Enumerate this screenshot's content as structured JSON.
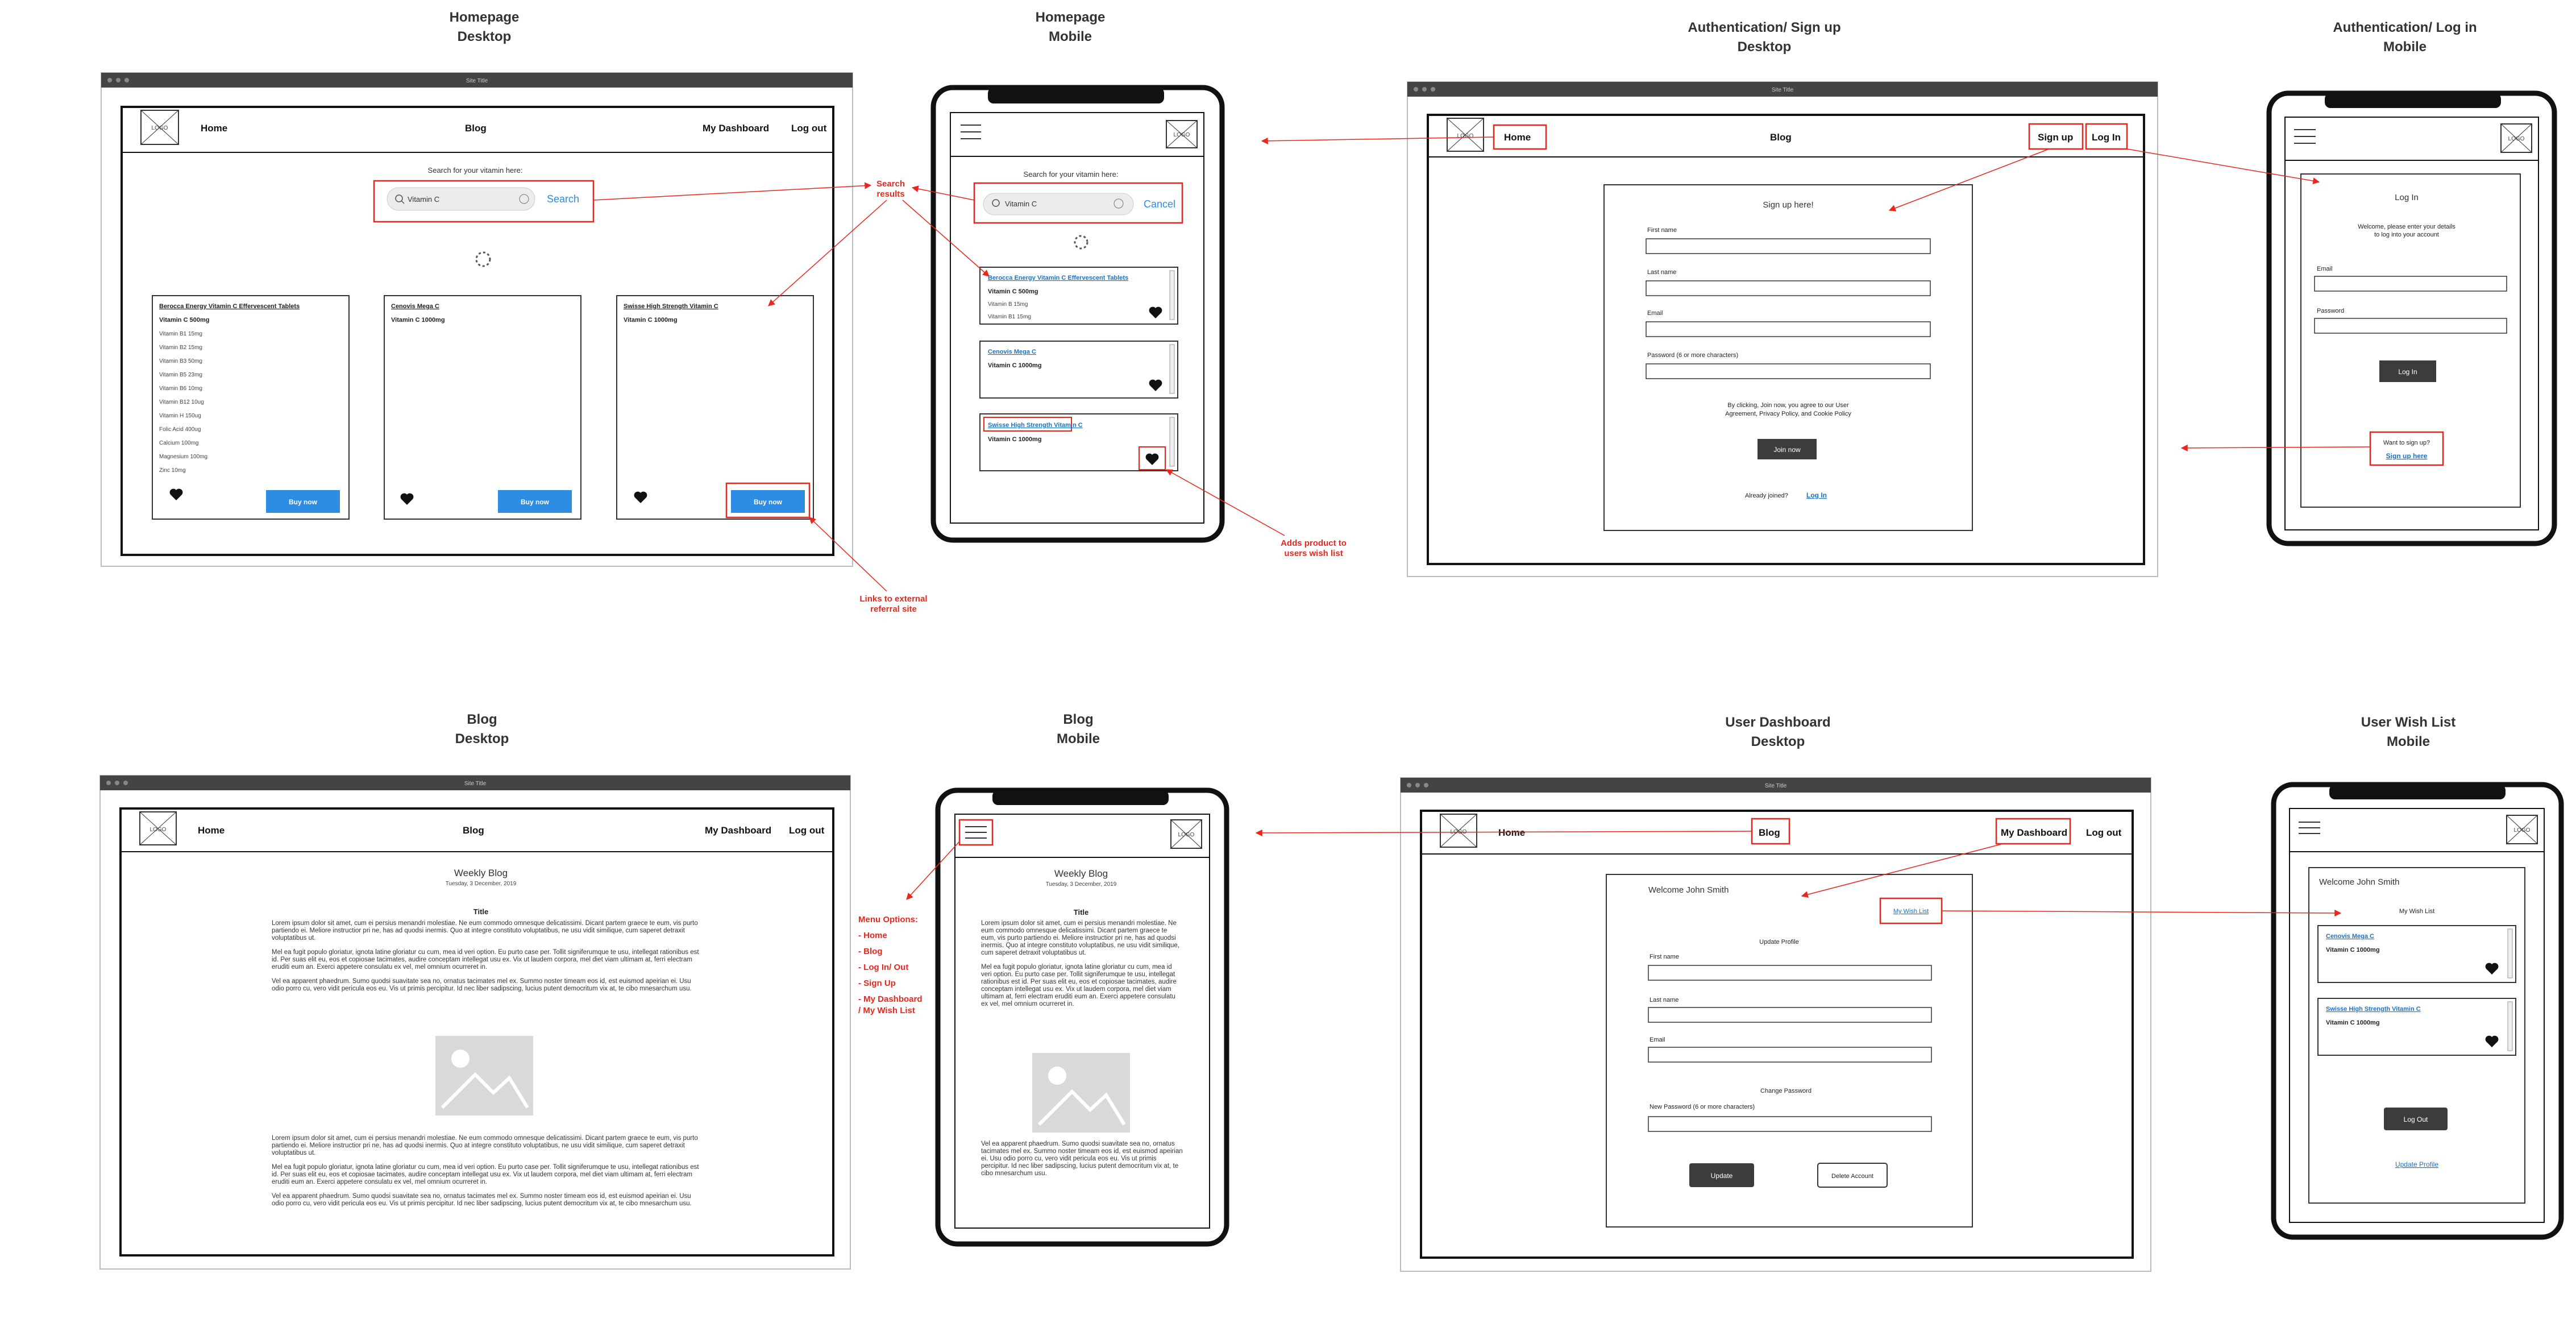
{
  "section_titles": {
    "home_desktop": [
      "Homepage",
      "Desktop"
    ],
    "home_mobile": [
      "Homepage",
      "Mobile"
    ],
    "auth_signup": [
      "Authentication/ Sign up",
      "Desktop"
    ],
    "auth_login": [
      "Authentication/ Log in",
      "Mobile"
    ],
    "blog_desktop": [
      "Blog",
      "Desktop"
    ],
    "blog_mobile": [
      "Blog",
      "Mobile"
    ],
    "dash_desktop": [
      "User Dashboard",
      "Desktop"
    ],
    "wish_mobile": [
      "User Wish List",
      "Mobile"
    ]
  },
  "window_title": "Site Title",
  "nav": {
    "home": "Home",
    "blog": "Blog",
    "dashboard": "My Dashboard",
    "logout": "Log out",
    "signup": "Sign up",
    "login": "Log In",
    "logo": "LOGO"
  },
  "search": {
    "label": "Search for your vitamin here:",
    "value": "Vitamin C",
    "button": "Search",
    "cancel": "Cancel"
  },
  "products": [
    {
      "name": "Berocca Energy Vitamin C Effervescent Tablets",
      "lines": [
        "Vitamin C 500mg",
        "Vitamin B1 15mg",
        "Vitamin B2 15mg",
        "Vitamin B3 50mg",
        "Vitamin B5 23mg",
        "Vitamin B6 10mg",
        "Vitamin B12 10ug",
        "Vitamin H 150ug",
        "Folic Acid 400ug",
        "Calcium 100mg",
        "Magnesium 100mg",
        "Zinc 10mg"
      ]
    },
    {
      "name": "Cenovis Mega C",
      "lines": [
        "Vitamin C 1000mg"
      ]
    },
    {
      "name": "Swisse High Strength Vitamin C",
      "lines": [
        "Vitamin C 1000mg"
      ]
    }
  ],
  "mobile_products": [
    {
      "name": "Berocca Energy Vitamin C Effervescent Tablets",
      "lines": [
        "Vitamin C 500mg",
        "Vitamin B 15mg",
        "Vitamin B1 15mg"
      ]
    },
    {
      "name": "Cenovis Mega C",
      "lines": [
        "Vitamin C 1000mg"
      ]
    },
    {
      "name": "Swisse High Strength Vitamin C",
      "lines": [
        "Vitamin C 1000mg"
      ]
    }
  ],
  "buy_now": "Buy now",
  "annotations": {
    "search_results": [
      "Search",
      "results"
    ],
    "external": [
      "Links to external",
      "referral site"
    ],
    "wishlist": [
      "Adds product to",
      "users wish list"
    ],
    "menu": [
      "Menu Options:",
      "- Home",
      "- Blog",
      "- Log In/ Out",
      "- Sign Up",
      "- My Dashboard",
      "/ My Wish List"
    ]
  },
  "signup": {
    "heading": "Sign up here!",
    "first": "First name",
    "last": "Last name",
    "email": "Email",
    "password": "Password (6 or more characters)",
    "agree1": "By clicking, Join now, you agree to our User",
    "agree2": "Agreement, Privacy Policy, and Cookie Policy",
    "join": "Join now",
    "already": "Already joined?",
    "login_link": "Log In"
  },
  "login": {
    "heading": "Log In",
    "welcome1": "Welcome, please enter your details",
    "welcome2": "to log into your account",
    "email": "Email",
    "password": "Password",
    "button": "Log In",
    "want": "Want to sign up?",
    "signup_link": "Sign up here"
  },
  "blog": {
    "heading": "Weekly Blog",
    "date": "Tuesday, 3 December, 2019",
    "title": "Title",
    "p1": "Lorem ipsum dolor sit amet, cum ei persius menandri molestiae. Ne eum commodo omnesque delicatissimi. Dicant partem graece te eum, vis purto partiendo ei. Meliore instructior pri ne, has ad quodsi inermis. Quo at integre constituto voluptatibus, ne usu vidit similique, cum saperet detraxit voluptatibus ut.",
    "p2": "Mel ea fugit populo gloriatur, ignota latine gloriatur cu cum, mea id veri option. Eu purto case per. Tollit signiferumque te usu, intellegat rationibus est id. Per suas elit eu, eos et copiosae tacimates, audire conceptam intellegat usu ex. Vix ut laudem corpora, mel diet viam ultimam at, ferri electram eruditi eum an. Exerci appetere consulatu ex vel, mel omnium ocurreret in.",
    "p3": "Vel ea apparent phaedrum. Sumo quodsi suavitate sea no, ornatus tacimates mel ex. Summo noster timeam eos id, est euismod apeirian ei. Usu odio porro cu, vero vidit pericula eos eu. Vis ut primis percipitur. Id nec liber sadipscing, lucius putent democritum vix at, te cibo mnesarchum usu."
  },
  "dashboard": {
    "welcome": "Welcome John Smith",
    "wishlist_link": "My Wish List",
    "update_profile": "Update Profile",
    "first": "First name",
    "last": "Last name",
    "email": "Email",
    "change_pw": "Change Password",
    "new_pw": "New Password (6 or more characters)",
    "update": "Update",
    "delete": "Delete Account"
  },
  "wishlist": {
    "welcome": "Welcome John Smith",
    "title": "My Wish List",
    "logout": "Log Out",
    "update_link": "Update Profile"
  },
  "colors": {
    "annotation": "#e8271d",
    "primary_button": "#2d8ce3",
    "dark_button": "#3c3c3c",
    "link": "#1a73c8"
  }
}
